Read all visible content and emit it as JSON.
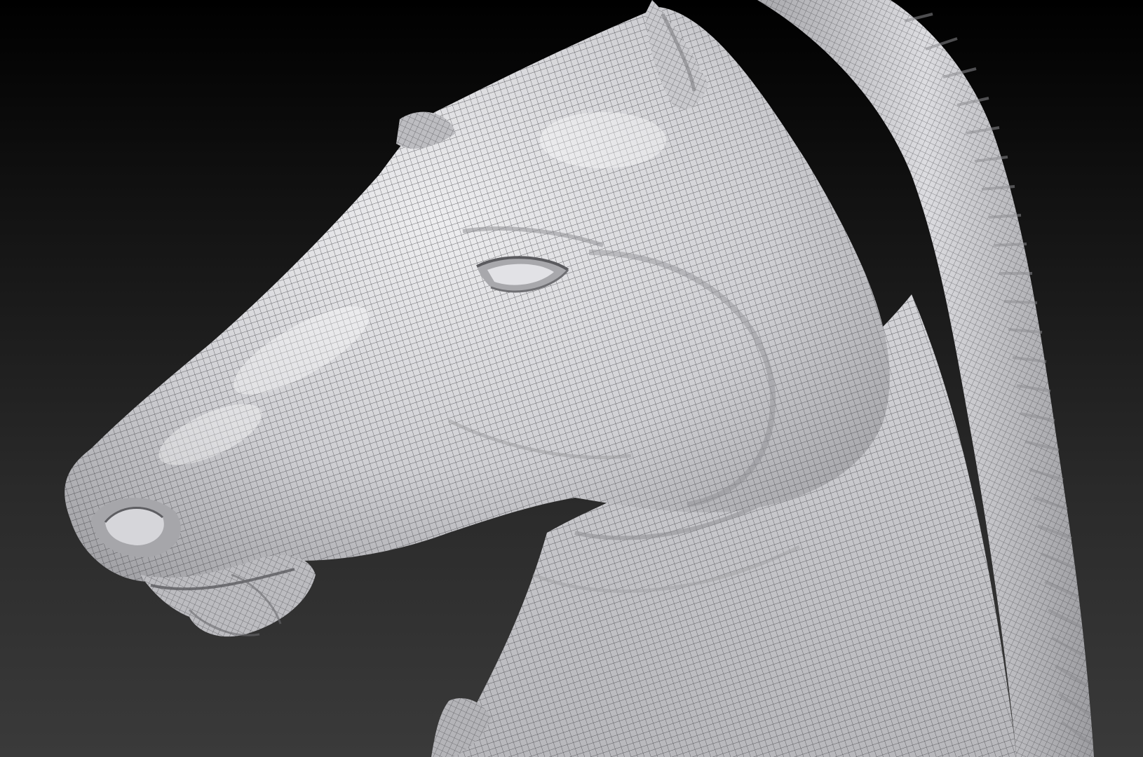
{
  "viewport": {
    "subject_icon": "horse-head-sculpt-icon",
    "background_top_color": "#000000",
    "background_bottom_color": "#3a3a3a",
    "mesh_color": "#d8d8dc",
    "wire_color": "#3c3c40"
  }
}
